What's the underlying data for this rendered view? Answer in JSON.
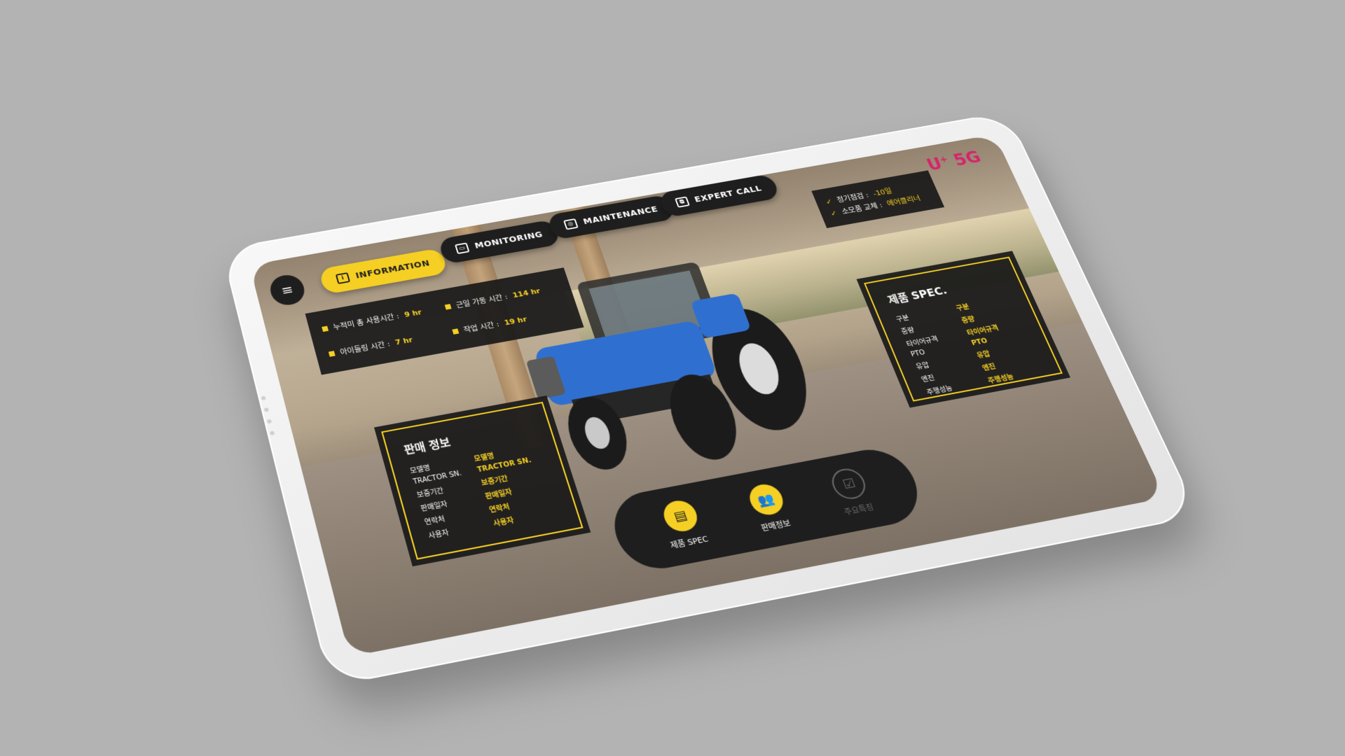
{
  "brand": {
    "logo": "U",
    "logo_sup": "+",
    "logo_5g": "5G"
  },
  "tabs": [
    {
      "label": "INFORMATION",
      "icon": "info-icon",
      "active": true
    },
    {
      "label": "MONITORING",
      "icon": "monitor-icon",
      "active": false
    },
    {
      "label": "MAINTENANCE",
      "icon": "camera-icon",
      "active": false
    },
    {
      "label": "EXPERT CALL",
      "icon": "network-icon",
      "active": false
    }
  ],
  "stats": [
    {
      "label": "누적미 총 사용시간 :",
      "value": "9 hr"
    },
    {
      "label": "근일 가동 시간 :",
      "value": "114 hr"
    },
    {
      "label": "아이들링 시간 :",
      "value": "7 hr"
    },
    {
      "label": "작업 시간 :",
      "value": "19 hr"
    }
  ],
  "checks": [
    {
      "label": "정기점검 :",
      "value": "-10일"
    },
    {
      "label": "소모품 교체 :",
      "value": "에어클리너"
    }
  ],
  "sales_info": {
    "title": "판매 정보",
    "rows": [
      {
        "k": "모델명",
        "v": "모델명"
      },
      {
        "k": "TRACTOR SN.",
        "v": "TRACTOR SN."
      },
      {
        "k": "보증기간",
        "v": "보증기간"
      },
      {
        "k": "판매일자",
        "v": "판매일자"
      },
      {
        "k": "연락처",
        "v": "연락처"
      },
      {
        "k": "사용자",
        "v": "사용자"
      }
    ]
  },
  "spec_info": {
    "title": "제품 SPEC.",
    "rows": [
      {
        "k": "구분",
        "v": "구분"
      },
      {
        "k": "중량",
        "v": "중량"
      },
      {
        "k": "타이어규격",
        "v": "타이어규격"
      },
      {
        "k": "PTO",
        "v": "PTO"
      },
      {
        "k": "유압",
        "v": "유압"
      },
      {
        "k": "엔진",
        "v": "엔진"
      },
      {
        "k": "주행성능",
        "v": "주행성능"
      }
    ]
  },
  "dock": [
    {
      "label": "제품 SPEC",
      "icon": "spec-icon",
      "enabled": true
    },
    {
      "label": "판매정보",
      "icon": "users-icon",
      "enabled": true
    },
    {
      "label": "주요특징",
      "icon": "checklist-icon",
      "enabled": false
    }
  ],
  "colors": {
    "accent": "#f5cf23",
    "panel": "#1e1e1e",
    "brand": "#d6246b",
    "tractor": "#2f6fd0"
  }
}
